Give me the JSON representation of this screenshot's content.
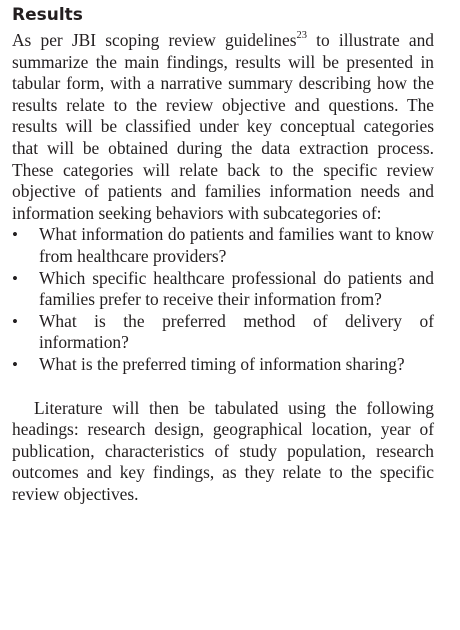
{
  "section": {
    "heading": "Results",
    "intro_before_ref": "As per JBI scoping review guidelines",
    "intro_ref": "23",
    "intro_after_ref": " to illustrate and summarize the main findings, results will be presented in tabular form, with a narrative summary describing how the results relate to the review objec­tive and questions. The results will be classified under key conceptual categories that will be obtained during the data extraction process. These categories will relate back to the specific review objective of patients and families information needs and information seeking behaviors with subcategories of:",
    "bullet_glyph": "•",
    "bullets": [
      "What information do patients and families want to know from healthcare providers?",
      "Which specific healthcare professional do patients and families prefer to receive their information from?",
      "What is the preferred method of delivery of information?",
      "What is the preferred timing of information sharing?"
    ],
    "closing": "Literature will then be tabulated using the following headings: research design, geographical location, year of publication, characteristics of study population, research outcomes and key findings, as they relate to the specific review objectives."
  }
}
